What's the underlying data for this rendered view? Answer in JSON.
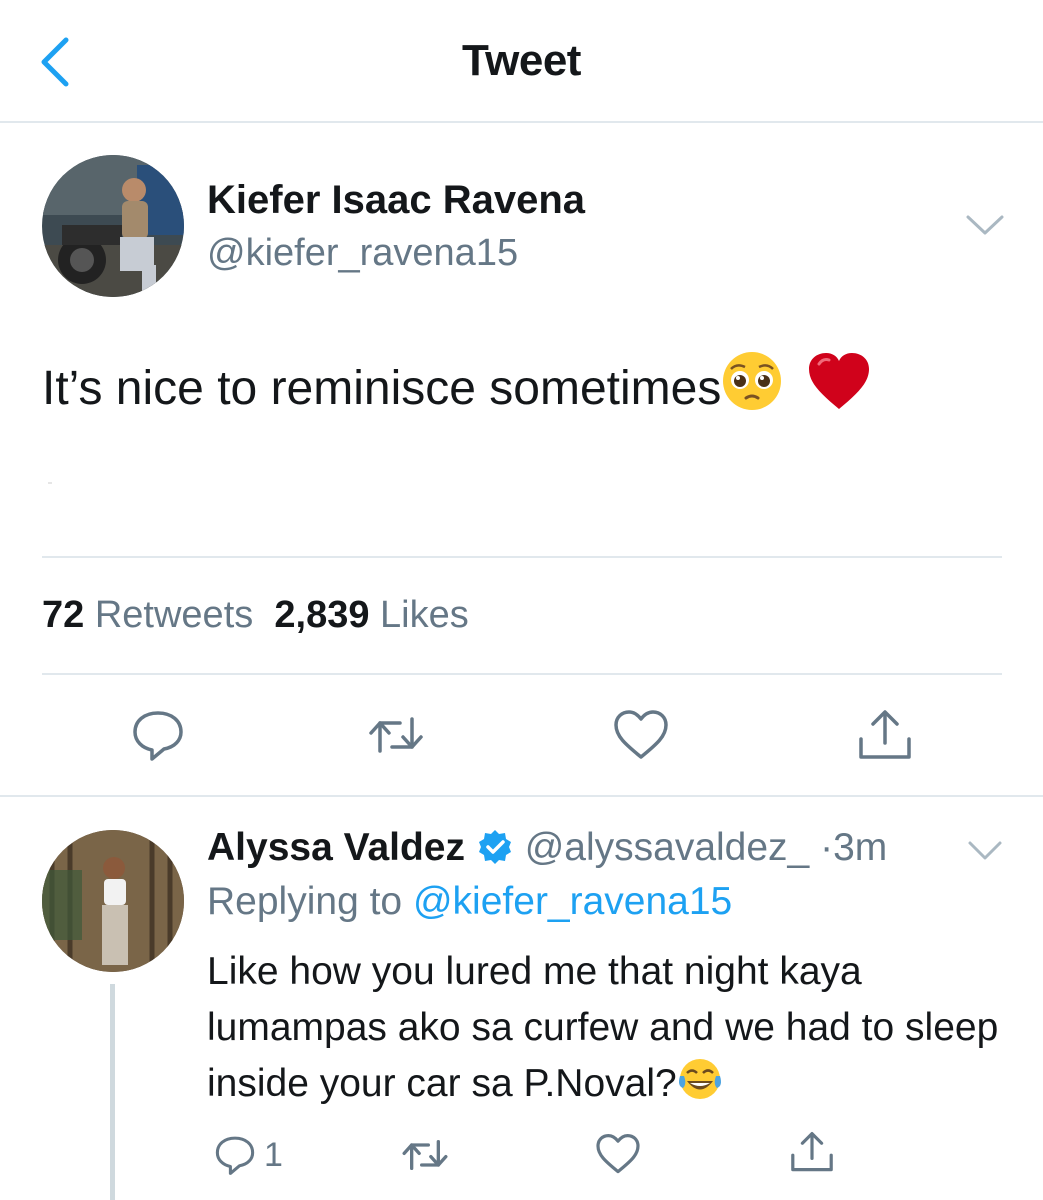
{
  "header": {
    "title": "Tweet",
    "back_icon": "chevron-left-icon"
  },
  "tweet": {
    "author_name": "Kiefer Isaac Ravena",
    "author_handle": "@kiefer_ravena15",
    "text": "It’s nice to reminisce sometimes",
    "emojis": [
      "pleading-face-emoji",
      "red-heart-emoji"
    ],
    "stats": {
      "retweets_count": "72",
      "retweets_label": "Retweets",
      "likes_count": "2,839",
      "likes_label": "Likes"
    },
    "actions": [
      "reply-icon",
      "retweet-icon",
      "like-icon",
      "share-icon"
    ]
  },
  "reply": {
    "author_name": "Alyssa Valdez",
    "verified": true,
    "author_handle": "@alyssavaldez_",
    "separator": "·",
    "time": "3m",
    "replying_prefix": "Replying to",
    "replying_handle": "@kiefer_ravena15",
    "text": "Like how you lured me that night kaya lumampas ako sa curfew and we had to sleep inside your car sa P.Noval?",
    "emoji": "tears-of-joy-emoji",
    "reply_count": "1"
  },
  "colors": {
    "accent": "#1da1f2",
    "secondary_text": "#657786",
    "heart": "#d0021b",
    "divider": "#e1e8ed"
  }
}
